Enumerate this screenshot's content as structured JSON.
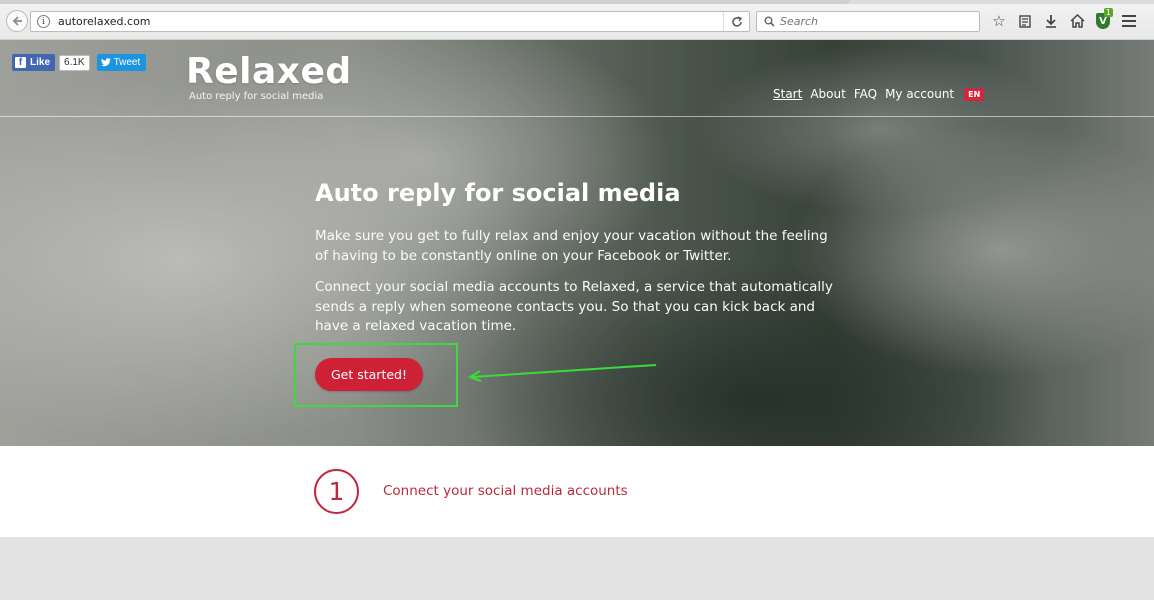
{
  "browser": {
    "url": "autorelaxed.com",
    "search_placeholder": "Search",
    "shield_badge": "1"
  },
  "social": {
    "like_label": "Like",
    "like_count": "6.1K",
    "tweet_label": "Tweet"
  },
  "site": {
    "logo": "Relaxed",
    "tagline": "Auto reply for social media"
  },
  "nav": {
    "items": [
      {
        "label": "Start"
      },
      {
        "label": "About"
      },
      {
        "label": "FAQ"
      },
      {
        "label": "My account"
      }
    ],
    "language": "EN"
  },
  "hero": {
    "title": "Auto reply for social media",
    "paragraph_1": "Make sure you get to fully relax and enjoy your vacation without the feeling of having to be constantly online on your Facebook or Twitter.",
    "paragraph_2": "Connect your social media accounts to Relaxed, a service that automatically sends a reply when someone contacts you. So that you can kick back and have a relaxed vacation time.",
    "cta_label": "Get started!"
  },
  "steps": [
    {
      "number": "1",
      "label": "Connect your social media accounts"
    }
  ],
  "colors": {
    "accent": "#cf2135",
    "highlight": "#3adb3a",
    "facebook": "#4267b2",
    "twitter": "#1b95e0"
  }
}
